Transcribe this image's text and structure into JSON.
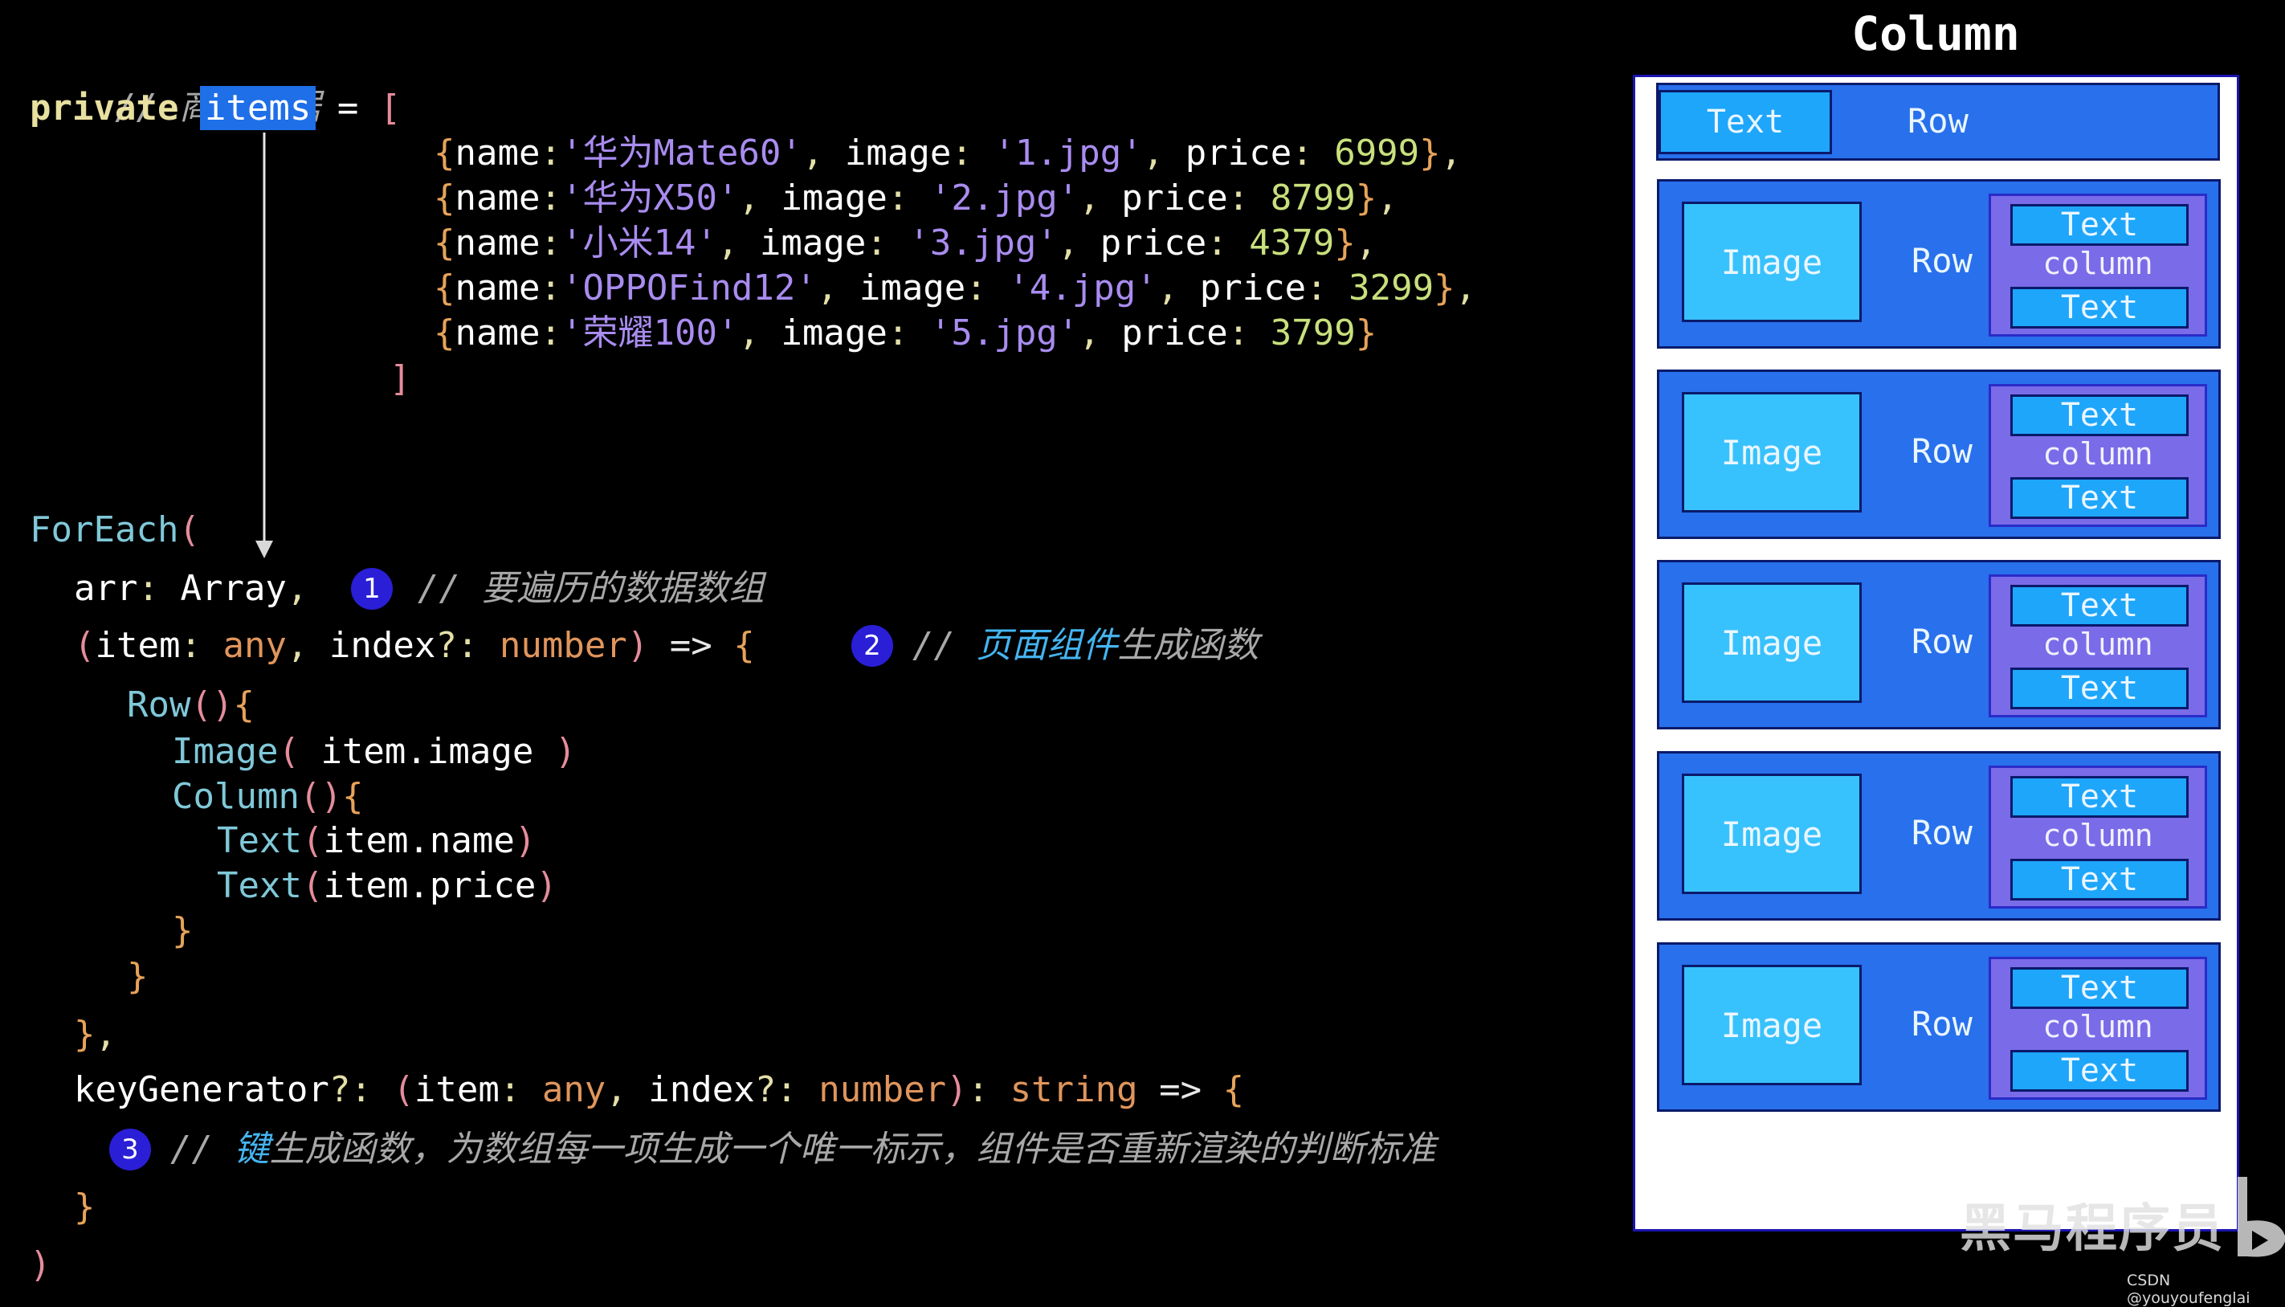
{
  "code": {
    "data_comment": "// 商品数据",
    "decl": {
      "keyword": "private",
      "identifier": "items",
      "assign": " = ",
      "open": "["
    },
    "items": [
      {
        "name": "华为Mate60",
        "image": "1.jpg",
        "price": "6999",
        "trail": ","
      },
      {
        "name": "华为X50",
        "image": "2.jpg",
        "price": "8799",
        "trail": ","
      },
      {
        "name": "小米14",
        "image": "3.jpg",
        "price": "4379",
        "trail": ","
      },
      {
        "name": "OPPOFind12",
        "image": "4.jpg",
        "price": "3299",
        "trail": ","
      },
      {
        "name": "荣耀100",
        "image": "5.jpg",
        "price": "3799",
        "trail": ""
      }
    ],
    "tokens": {
      "name_key": "name",
      "image_key": "image",
      "price_key": "price",
      "colon": ":",
      "comma_sp": ", ",
      "lbrace": "{",
      "rbrace": "}",
      "quote": "'",
      "close_bracket": "]"
    },
    "foreach": {
      "fn": "ForEach",
      "open_paren": "(",
      "arr_param": "arr",
      "arr_colon": ": ",
      "arr_type": "Array",
      "arr_comma": ",",
      "arr_comment": "// 要遍历的数据数组",
      "item_fn_open": "(",
      "item": "item",
      "item_colon": ": ",
      "any": "any",
      "sep": ", ",
      "index": "index",
      "opt_colon": "?: ",
      "number": "number",
      "item_fn_close": ")",
      "arrow": " => ",
      "body_open": "{",
      "item_fn_comment_prefix": "// ",
      "item_fn_comment_hl": "页面组件",
      "item_fn_comment_rest": "生成函数",
      "row_fn": "Row",
      "row_parens": "()",
      "row_open": "{",
      "image_fn": "Image",
      "image_open": "(",
      "image_arg": " item.image ",
      "image_close": ")",
      "column_fn": "Column",
      "column_parens": "()",
      "column_open": "{",
      "text_fn": "Text",
      "text_open": "(",
      "text_arg_name": "item.name",
      "text_arg_price": "item.price",
      "text_close": ")",
      "close_brace": "}",
      "close_brace_comma": "},",
      "comma": ",",
      "key_gen": "keyGenerator",
      "key_opt": "?: ",
      "key_ret_colon": ": ",
      "string": "string",
      "key_comment_prefix": "// ",
      "key_comment_hl": "键",
      "key_comment_rest": "生成函数，为数组每一项生成一个唯一标示，组件是否重新渲染的判断标准",
      "final_paren": ")"
    },
    "badges": [
      "1",
      "2",
      "3"
    ]
  },
  "diagram": {
    "title": "Column",
    "header_row": {
      "text": "Text",
      "label": "Row"
    },
    "item_rows": [
      {
        "image": "Image",
        "label": "Row",
        "column_label": "column",
        "text_top": "Text",
        "text_bottom": "Text"
      },
      {
        "image": "Image",
        "label": "Row",
        "column_label": "column",
        "text_top": "Text",
        "text_bottom": "Text"
      },
      {
        "image": "Image",
        "label": "Row",
        "column_label": "column",
        "text_top": "Text",
        "text_bottom": "Text"
      },
      {
        "image": "Image",
        "label": "Row",
        "column_label": "column",
        "text_top": "Text",
        "text_bottom": "Text"
      },
      {
        "image": "Image",
        "label": "Row",
        "column_label": "column",
        "text_top": "Text",
        "text_bottom": "Text"
      }
    ]
  },
  "watermark": {
    "brand": "黑马程序员",
    "credit": "CSDN @youyoufenglai"
  },
  "colors": {
    "highlight": "#1f6fe8",
    "badge": "#2a1fd6",
    "row": "#2870ec",
    "column": "#7a6be8",
    "text_box": "#1ea6fb",
    "image_box": "#38c2fd"
  }
}
